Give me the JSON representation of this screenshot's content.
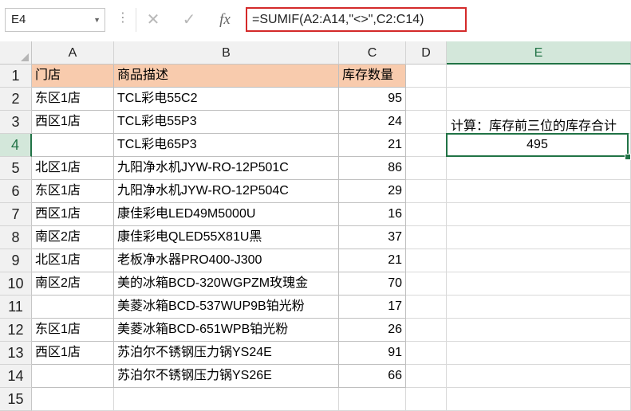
{
  "namebox": {
    "value": "E4"
  },
  "formula_bar": {
    "cancel": "✕",
    "enter": "✓",
    "fx": "fx",
    "formula": "=SUMIF(A2:A14,\"<>\",C2:C14)"
  },
  "columns": [
    "A",
    "B",
    "C",
    "D",
    "E"
  ],
  "rows": [
    "1",
    "2",
    "3",
    "4",
    "5",
    "6",
    "7",
    "8",
    "9",
    "10",
    "11",
    "12",
    "13",
    "14",
    "15"
  ],
  "table": {
    "headers": {
      "store": "门店",
      "desc": "商品描述",
      "qty": "库存数量"
    },
    "data": [
      {
        "store": "东区1店",
        "desc": "TCL彩电55C2",
        "qty": "95"
      },
      {
        "store": "西区1店",
        "desc": "TCL彩电55P3",
        "qty": "24"
      },
      {
        "store": "",
        "desc": "TCL彩电65P3",
        "qty": "21"
      },
      {
        "store": "北区1店",
        "desc": "九阳净水机JYW-RO-12P501C",
        "qty": "86"
      },
      {
        "store": "东区1店",
        "desc": "九阳净水机JYW-RO-12P504C",
        "qty": "29"
      },
      {
        "store": "西区1店",
        "desc": "康佳彩电LED49M5000U",
        "qty": "16"
      },
      {
        "store": "南区2店",
        "desc": "康佳彩电QLED55X81U黑",
        "qty": "37"
      },
      {
        "store": "北区1店",
        "desc": "老板净水器PRO400-J300",
        "qty": "21"
      },
      {
        "store": "南区2店",
        "desc": "美的冰箱BCD-320WGPZM玫瑰金",
        "qty": "70"
      },
      {
        "store": "",
        "desc": "美菱冰箱BCD-537WUP9B铂光粉",
        "qty": "17"
      },
      {
        "store": "东区1店",
        "desc": "美菱冰箱BCD-651WPB铂光粉",
        "qty": "26"
      },
      {
        "store": "西区1店",
        "desc": "苏泊尔不锈钢压力锅YS24E",
        "qty": "91"
      },
      {
        "store": "",
        "desc": "苏泊尔不锈钢压力锅YS26E",
        "qty": "66"
      }
    ]
  },
  "calc": {
    "label": "计算：库存前三位的库存合计",
    "result": "495"
  },
  "colors": {
    "header_fill": "#f8cbad",
    "selection": "#217346",
    "formula_highlight": "#d42a2a"
  }
}
